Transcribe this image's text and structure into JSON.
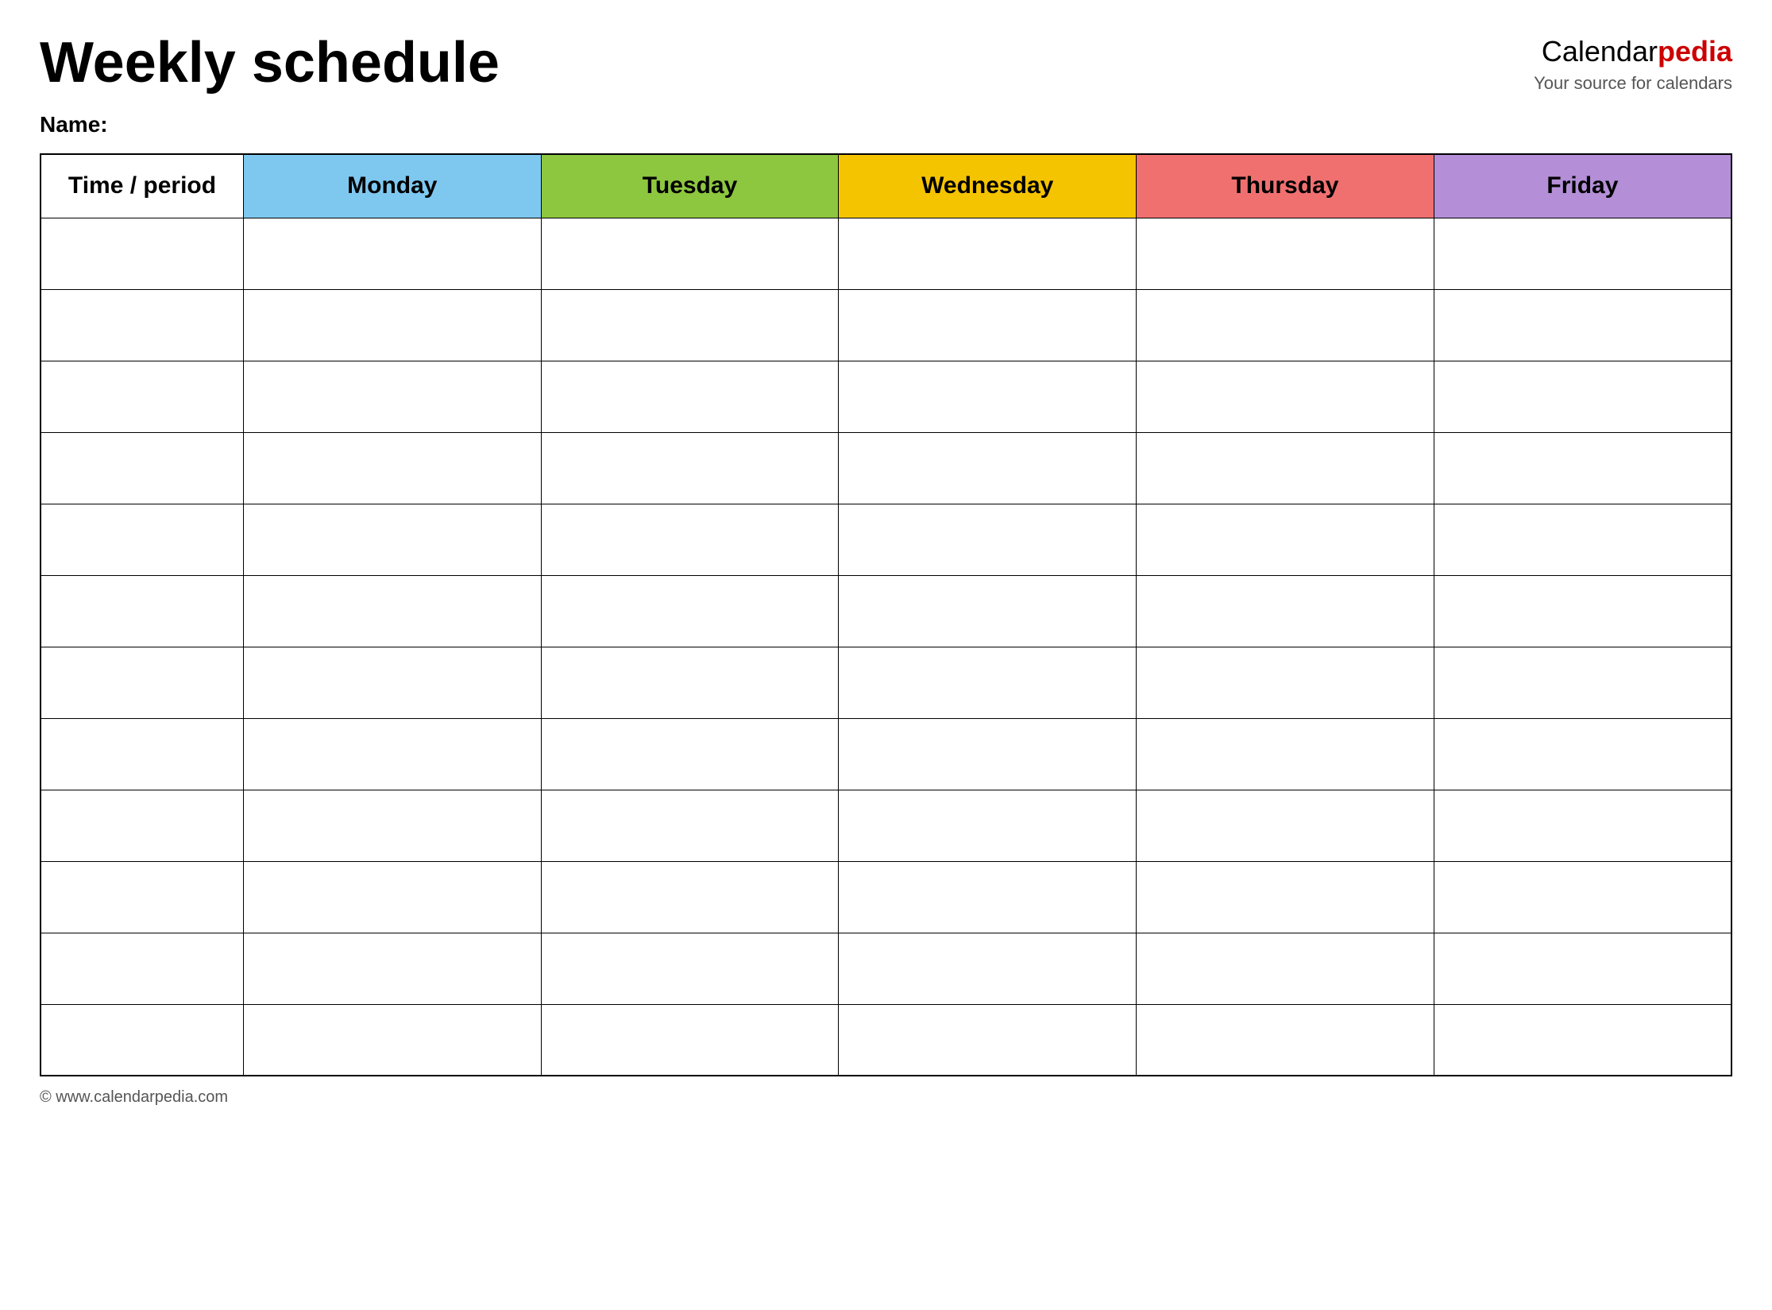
{
  "header": {
    "title": "Weekly schedule",
    "brand_calendar": "Calendar",
    "brand_pedia": "pedia",
    "brand_tagline": "Your source for calendars"
  },
  "name_label": "Name:",
  "table": {
    "columns": [
      {
        "id": "time",
        "label": "Time / period",
        "color": "#ffffff"
      },
      {
        "id": "monday",
        "label": "Monday",
        "color": "#7ec8f0"
      },
      {
        "id": "tuesday",
        "label": "Tuesday",
        "color": "#8dc63f"
      },
      {
        "id": "wednesday",
        "label": "Wednesday",
        "color": "#f5c400"
      },
      {
        "id": "thursday",
        "label": "Thursday",
        "color": "#f07070"
      },
      {
        "id": "friday",
        "label": "Friday",
        "color": "#b48fd8"
      }
    ],
    "row_count": 12
  },
  "footer": {
    "copyright": "© www.calendarpedia.com"
  }
}
